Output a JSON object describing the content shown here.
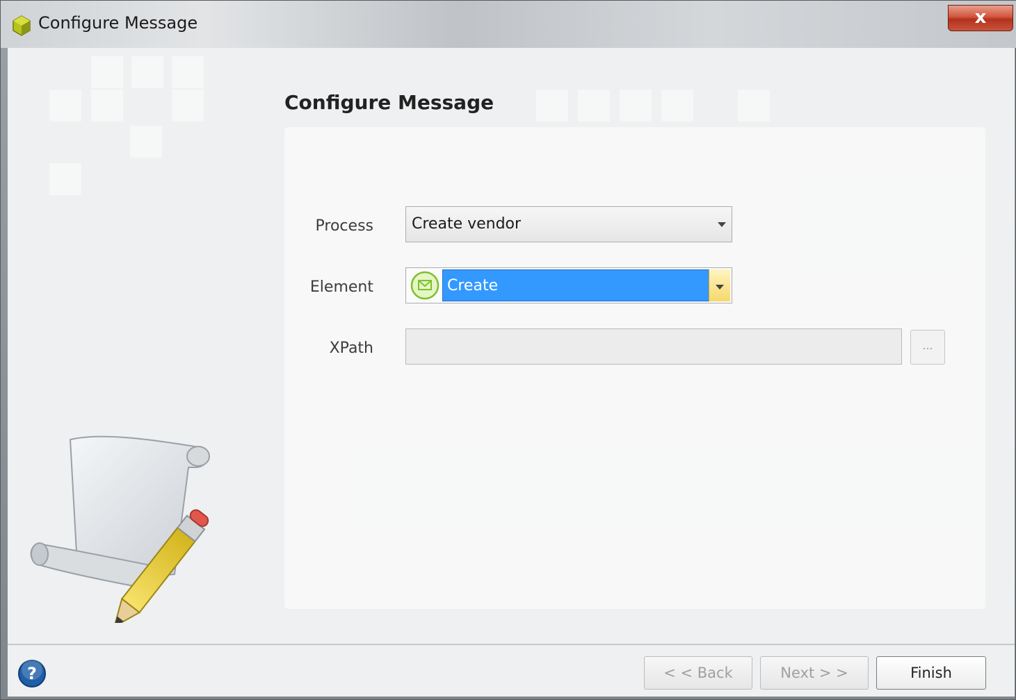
{
  "window": {
    "title": "Configure Message",
    "close_label": "x"
  },
  "page": {
    "heading": "Configure Message"
  },
  "form": {
    "process": {
      "label": "Process",
      "value": "Create vendor"
    },
    "element": {
      "label": "Element",
      "value": "Create"
    },
    "xpath": {
      "label": "XPath",
      "value": "",
      "browse_label": "..."
    }
  },
  "footer": {
    "back_label": "< < Back",
    "next_label": "Next > >",
    "finish_label": "Finish"
  },
  "icons": {
    "app": "gear-app-icon",
    "element": "envelope-icon",
    "help": "help-icon",
    "illustration": "scroll-pencil-icon"
  },
  "colors": {
    "selection": "#3399ff",
    "close": "#c8543b",
    "help": "#1f5fa8"
  }
}
